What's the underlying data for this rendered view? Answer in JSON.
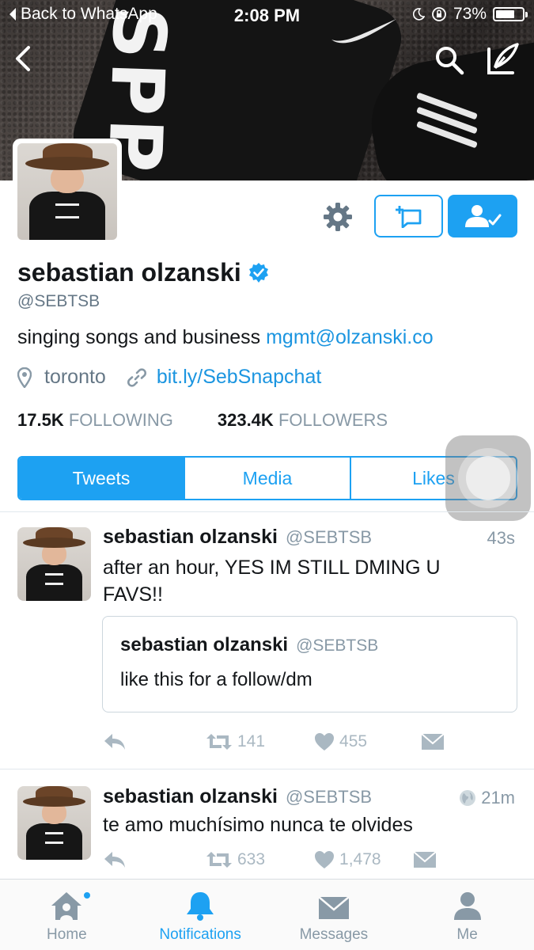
{
  "status_bar": {
    "back_label": "Back to WhatsApp",
    "time": "2:08 PM",
    "battery": "73%",
    "battery_level": 0.73
  },
  "banner": {
    "brand_text": "SPPI"
  },
  "profile": {
    "name": "sebastian olzanski",
    "handle": "@SEBTSB",
    "bio_text": "singing songs and business ",
    "bio_link": "mgmt@olzanski.co",
    "location": "toronto",
    "website": "bit.ly/SebSnapchat",
    "following_count": "17.5K",
    "following_label": "FOLLOWING",
    "followers_count": "323.4K",
    "followers_label": "FOLLOWERS"
  },
  "tabs": [
    "Tweets",
    "Media",
    "Likes"
  ],
  "tweets": [
    {
      "name": "sebastian olzanski",
      "handle": "@SEBTSB",
      "time": "43s",
      "text": "after an hour, YES IM STILL DMING U FAVS!!",
      "quote": {
        "name": "sebastian olzanski",
        "handle": "@SEBTSB",
        "text": "like this for a follow/dm"
      },
      "retweets": "141",
      "likes": "455"
    },
    {
      "name": "sebastian olzanski",
      "handle": "@SEBTSB",
      "time": "21m",
      "text": "te amo muchísimo nunca te olvides",
      "retweets": "633",
      "likes": "1,478"
    }
  ],
  "tab_bar": {
    "home": "Home",
    "notifications": "Notifications",
    "messages": "Messages",
    "me": "Me"
  },
  "colors": {
    "accent": "#1da1f2",
    "link": "#1b95e0",
    "muted": "#8899a6"
  },
  "icons": [
    "back-arrow-icon",
    "search-icon",
    "compose-icon",
    "gear-icon",
    "add-to-list-icon",
    "following-icon",
    "verified-icon",
    "location-icon",
    "link-icon",
    "reply-icon",
    "retweet-icon",
    "heart-icon",
    "dm-icon",
    "globe-icon",
    "home-icon",
    "bell-icon",
    "envelope-icon",
    "person-icon"
  ]
}
